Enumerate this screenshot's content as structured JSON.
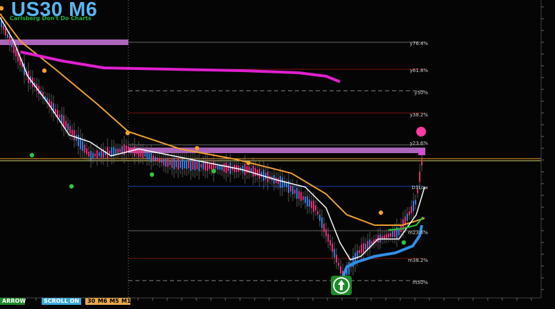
{
  "header": {
    "title": "US30 M6",
    "subtitle": "Carlsberg Don't Do Charts"
  },
  "levels": [
    {
      "label": "y76.4%",
      "color": "#666666",
      "dash": false
    },
    {
      "label": "y61.8%",
      "color": "#7a1010",
      "dash": false
    },
    {
      "label": "y50%",
      "color": "#888888",
      "dash": true
    },
    {
      "label": "y38.2%",
      "color": "#7a1010",
      "dash": false
    },
    {
      "label": "y23.6%",
      "color": "#666666",
      "dash": false
    },
    {
      "label": "D1Low",
      "color": "#1c3fb8",
      "dash": false
    },
    {
      "label": "m23.6%",
      "color": "#666666",
      "dash": false
    },
    {
      "label": "m38.2%",
      "color": "#7a1010",
      "dash": false
    },
    {
      "label": "m50%",
      "color": "#888888",
      "dash": true
    }
  ],
  "toolbar": {
    "arrow_label": "ARROW",
    "scroll_label": "SCROLL ON",
    "tf_30": "30",
    "tf_m6": "M6",
    "tf_m5": "M5",
    "tf_m1": "M1"
  },
  "colors": {
    "accent_title": "#5ab4f0",
    "bull_candle": "#3a7bd5",
    "bear_candle": "#e0307a",
    "ema_white": "#ffffff",
    "ema_orange": "#f0a030",
    "ema_magenta": "#e020d0",
    "ema_blue": "#2f8fe8",
    "ema_green": "#2cc640"
  },
  "icons": [
    "buy-arrow-icon"
  ]
}
